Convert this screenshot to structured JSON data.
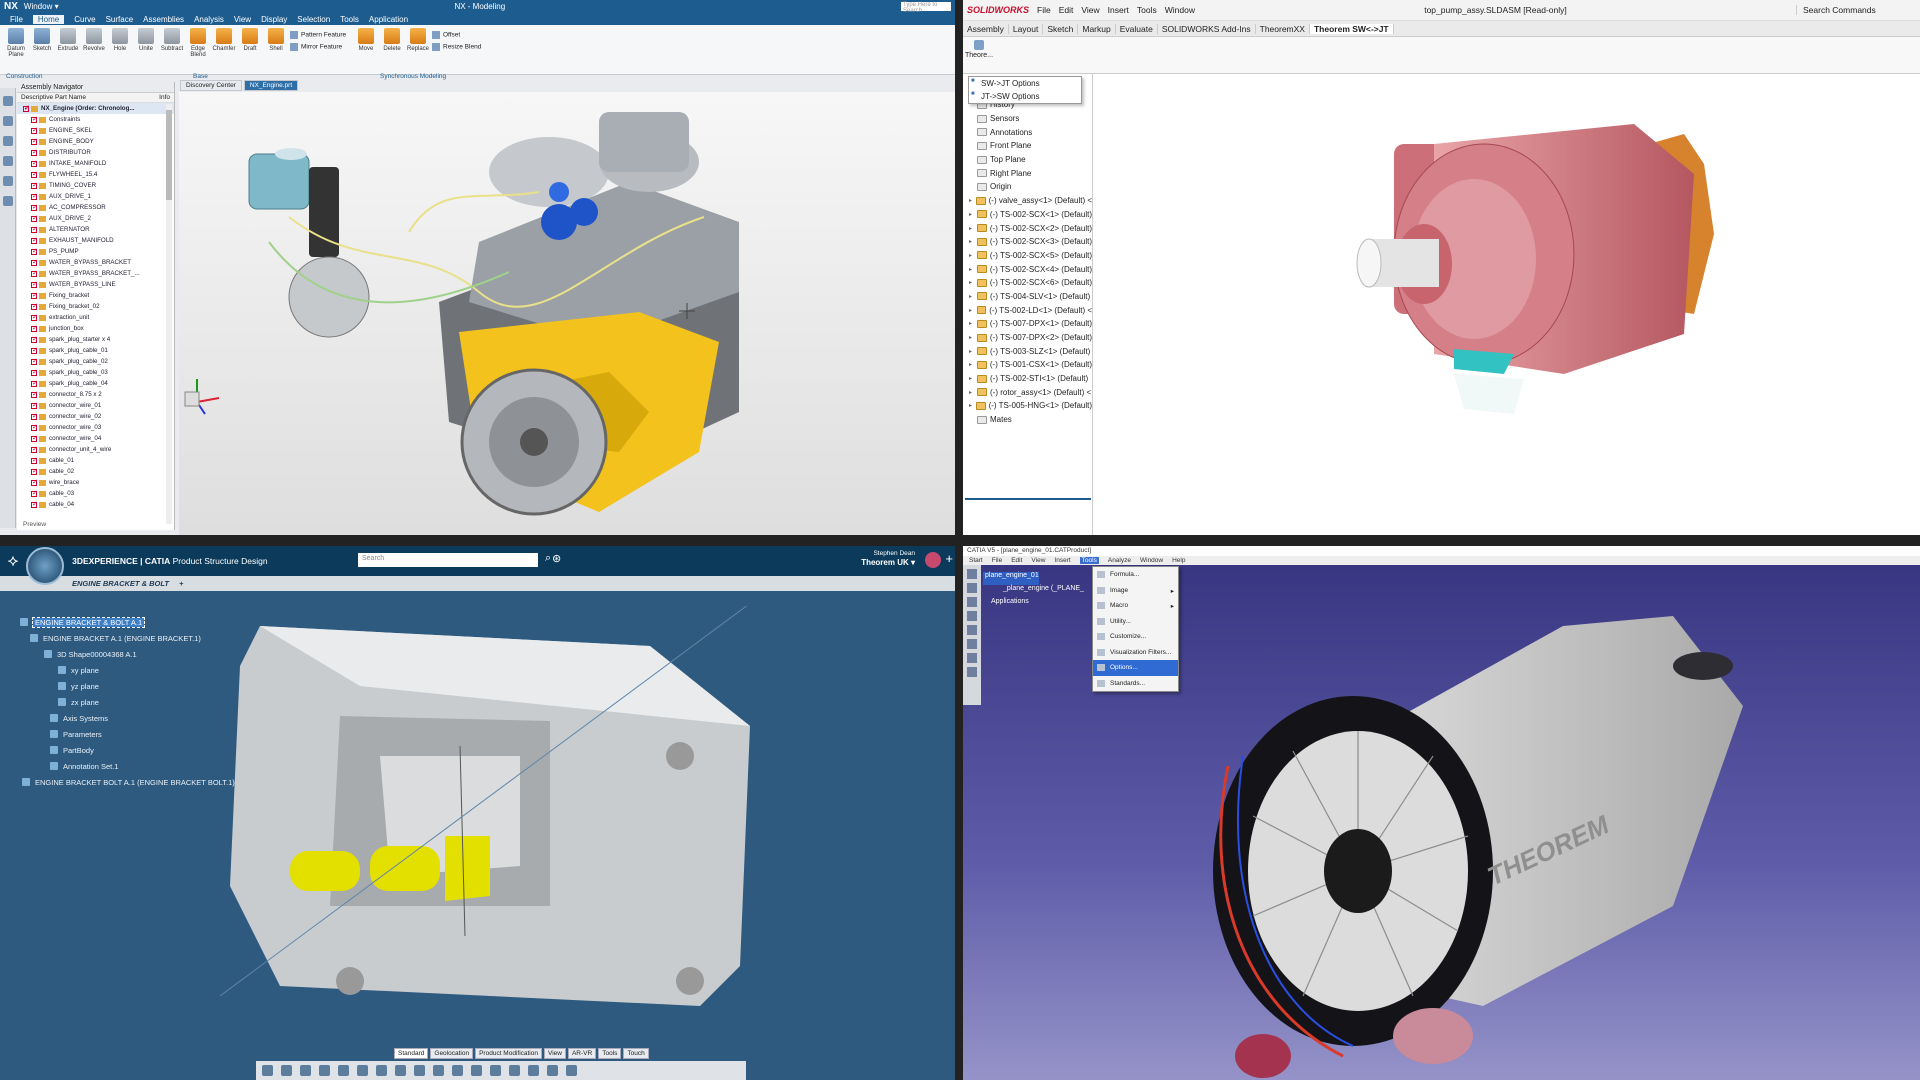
{
  "nx": {
    "app_logo": "NX",
    "window_menu": "Window ▾",
    "title": "NX - Modeling",
    "search_placeholder": "Type Here to Search",
    "menu": [
      "File",
      "Home",
      "Curve",
      "Surface",
      "Assemblies",
      "Analysis",
      "View",
      "Display",
      "Selection",
      "Tools",
      "Application"
    ],
    "active_menu": "Home",
    "ribbon_buttons": [
      "Datum Plane",
      "Sketch",
      "Extrude",
      "Revolve",
      "Hole",
      "Unite",
      "Subtract",
      "Edge Blend",
      "Chamfer",
      "Draft",
      "Shell"
    ],
    "ribbon_small": [
      "Pattern Feature",
      "Mirror Feature"
    ],
    "ribbon_buttons2": [
      "Move",
      "Delete",
      "Replace"
    ],
    "ribbon_small2": [
      "Offset",
      "Resize Blend"
    ],
    "groups": {
      "construction": "Construction",
      "base": "Base",
      "sync": "Synchronous Modeling"
    },
    "navigator_title": "Assembly Navigator",
    "col_name": "Descriptive Part Name",
    "col_info": "Info",
    "tree_root": "NX_Engine (Order: Chronolog...",
    "tree_items": [
      "Constraints",
      "ENGINE_SKEL",
      "ENGINE_BODY",
      "DISTRIBUTOR",
      "INTAKE_MANIFOLD",
      "FLYWHEEL_15.4",
      "TIMING_COVER",
      "AUX_DRIVE_1",
      "AC_COMPRESSOR",
      "AUX_DRIVE_2",
      "ALTERNATOR",
      "EXHAUST_MANIFOLD",
      "PS_PUMP",
      "WATER_BYPASS_BRACKET",
      "WATER_BYPASS_BRACKET_...",
      "WATER_BYPASS_LINE",
      "Fixing_bracket",
      "Fixing_bracket_02",
      "extraction_unit",
      "junction_box",
      "spark_plug_starter x 4",
      "spark_plug_cable_01",
      "spark_plug_cable_02",
      "spark_plug_cable_03",
      "spark_plug_cable_04",
      "connector_8.75 x 2",
      "connector_wire_01",
      "connector_wire_02",
      "connector_wire_03",
      "connector_wire_04",
      "connector_unit_4_wire",
      "cable_01",
      "cable_02",
      "wire_brace",
      "cable_03",
      "cable_04"
    ],
    "preview": "Preview",
    "tabs": [
      "Discovery Center",
      "NX_Engine.prt"
    ],
    "active_tab": "NX_Engine.prt"
  },
  "sw": {
    "logo": "SOLIDWORKS",
    "menu": [
      "File",
      "Edit",
      "View",
      "Insert",
      "Tools",
      "Window"
    ],
    "title": "top_pump_assy.SLDASM [Read-only]",
    "search": "Search Commands",
    "tabs": [
      "Assembly",
      "Layout",
      "Sketch",
      "Markup",
      "Evaluate",
      "SOLIDWORKS Add-Ins",
      "TheoremXX",
      "Theorem SW<->JT"
    ],
    "active_tab": "Theorem SW<->JT",
    "cmd_button": "Theore...",
    "popup": [
      "SW->JT Options",
      "JT->SW Options"
    ],
    "tree": [
      "History",
      "Sensors",
      "Annotations",
      "Front Plane",
      "Top Plane",
      "Right Plane",
      "Origin",
      "(-) valve_assy<1> (Default) <",
      "(-) TS-002-SCX<1> (Default)",
      "(-) TS-002-SCX<2> (Default)",
      "(-) TS-002-SCX<3> (Default)",
      "(-) TS-002-SCX<5> (Default)",
      "(-) TS-002-SCX<4> (Default)",
      "(-) TS-002-SCX<6> (Default)",
      "(-) TS-004-SLV<1> (Default)",
      "(-) TS-002-LD<1> (Default) <",
      "(-) TS-007-DPX<1> (Default)",
      "(-) TS-007-DPX<2> (Default)",
      "(-) TS-003-SLZ<1> (Default)",
      "(-) TS-001-CSX<1> (Default)",
      "(-) TS-002-STI<1> (Default)",
      "(-) rotor_assy<1> (Default) <",
      "(-) TS-005-HNG<1> (Default)",
      "Mates"
    ]
  },
  "tdx": {
    "brand": "3DEXPERIENCE | CATIA",
    "app": "Product Structure Design",
    "search_placeholder": "Search",
    "user_name": "Stephen Dean",
    "user_org": "Theorem UK ▾",
    "tab": "ENGINE BRACKET & BOLT",
    "tree": [
      "ENGINE BRACKET & BOLT A.1",
      "ENGINE BRACKET A.1 (ENGINE BRACKET.1)",
      "3D Shape00004368 A.1",
      "xy plane",
      "yz plane",
      "zx plane",
      "Axis Systems",
      "Parameters",
      "PartBody",
      "Annotation Set.1",
      "ENGINE BRACKET BOLT A.1 (ENGINE BRACKET BOLT.1)"
    ],
    "toolbar_tabs": [
      "Standard",
      "Geolocation",
      "Product Modification",
      "View",
      "AR-VR",
      "Tools",
      "Touch"
    ]
  },
  "catia": {
    "title": "CATIA V5 - [plane_engine_01.CATProduct]",
    "menu": [
      "Start",
      "File",
      "Edit",
      "View",
      "Insert",
      "Tools",
      "Analyze",
      "Window",
      "Help"
    ],
    "active_menu": "Tools",
    "tree": [
      "plane_engine_01",
      "_plane_engine (_PLANE_",
      "Applications"
    ],
    "dropdown": [
      "Formula...",
      "Image",
      "Macro",
      "Utility...",
      "Customize...",
      "Visualization Filters...",
      "Options...",
      "Standards..."
    ],
    "dropdown_highlight": "Options...",
    "watermark": "THEOREM"
  }
}
